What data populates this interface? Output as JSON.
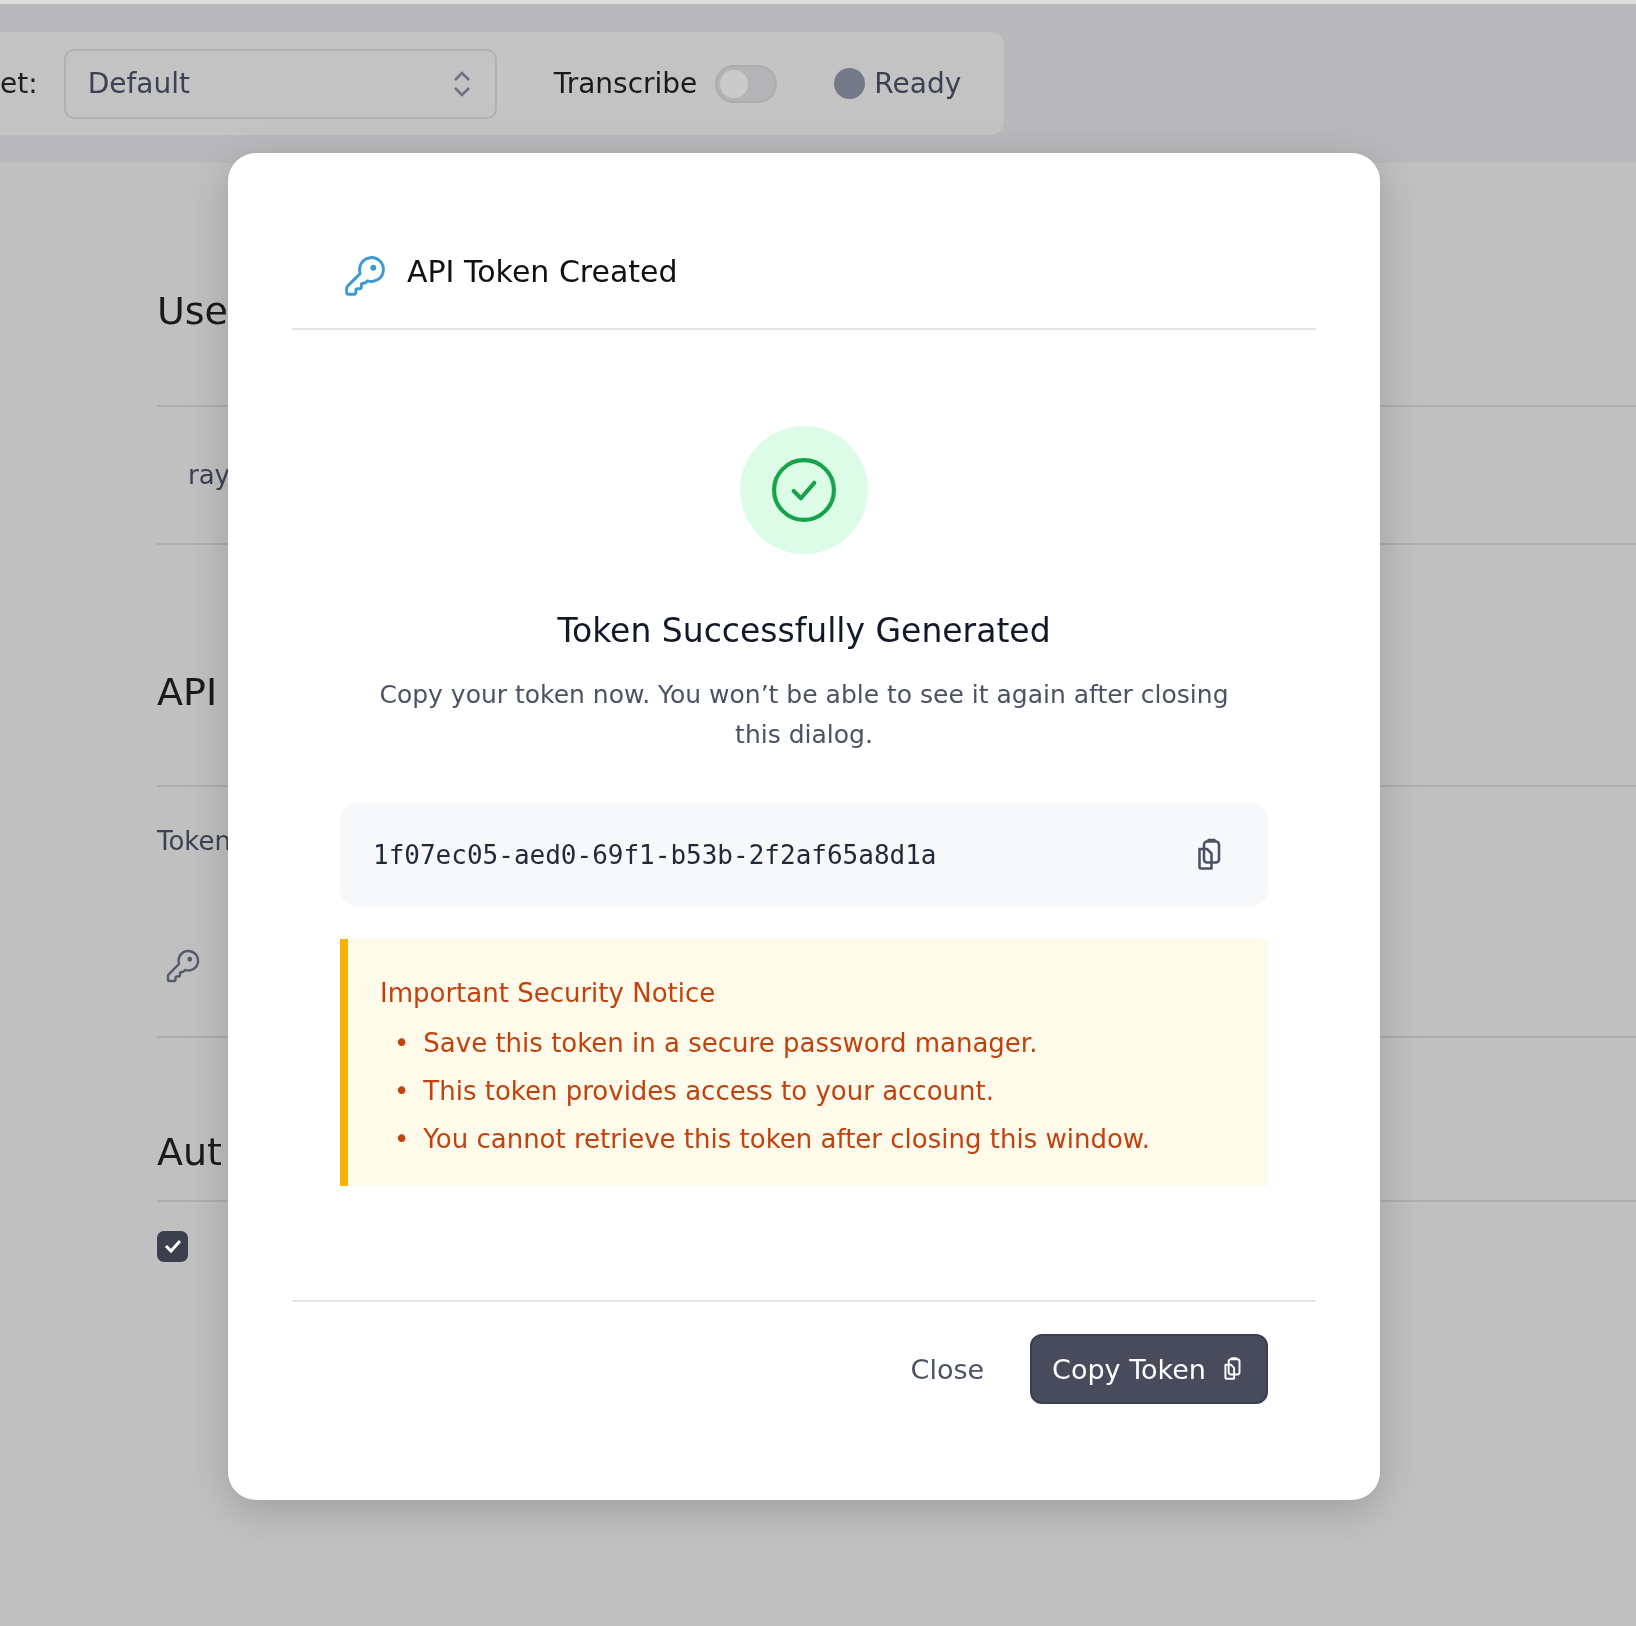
{
  "toolbar": {
    "preset_label": "et:",
    "preset_select": {
      "value": "Default"
    },
    "transcribe": {
      "label": "Transcribe",
      "on": false
    },
    "status": {
      "label": "Ready"
    }
  },
  "background": {
    "sections": [
      {
        "heading": "Use",
        "rows": [
          {
            "kind": "text",
            "text": "ray"
          }
        ]
      },
      {
        "heading": "API",
        "rows": [
          {
            "kind": "label",
            "text": "Token"
          },
          {
            "kind": "key"
          }
        ]
      },
      {
        "heading": "Aut",
        "rows": [
          {
            "kind": "checkbox",
            "checked": true
          }
        ]
      }
    ]
  },
  "dialog": {
    "title": "API Token Created",
    "heading": "Token Successfully Generated",
    "message": "Copy your token now. You won’t be able to see it again after closing this dialog.",
    "token": "1f07ec05-aed0-69f1-b53b-2f2af65a8d1a",
    "notice": {
      "title": "Important Security Notice",
      "marker": "•",
      "items": [
        "Save this token in a secure password manager.",
        "This token provides access to your account.",
        "You cannot retrieve this token after closing this window."
      ]
    },
    "buttons": [
      {
        "label": "Close",
        "kind": "secondary"
      },
      {
        "label": "Copy Token",
        "kind": "primary"
      }
    ]
  }
}
